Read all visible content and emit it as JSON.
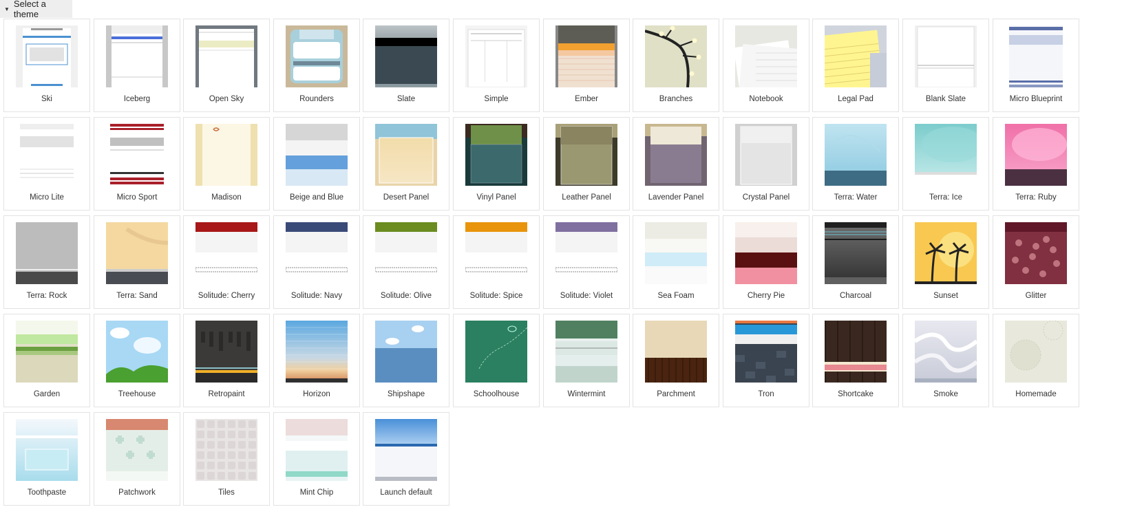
{
  "header": {
    "title": "Select a theme",
    "caret_icon": "caret-down-icon"
  },
  "themes": [
    {
      "id": "ski",
      "label": "Ski"
    },
    {
      "id": "iceberg",
      "label": "Iceberg"
    },
    {
      "id": "open-sky",
      "label": "Open Sky"
    },
    {
      "id": "rounders",
      "label": "Rounders"
    },
    {
      "id": "slate",
      "label": "Slate"
    },
    {
      "id": "simple",
      "label": "Simple"
    },
    {
      "id": "ember",
      "label": "Ember"
    },
    {
      "id": "branches",
      "label": "Branches"
    },
    {
      "id": "notebook",
      "label": "Notebook"
    },
    {
      "id": "legal-pad",
      "label": "Legal Pad"
    },
    {
      "id": "blank-slate",
      "label": "Blank Slate"
    },
    {
      "id": "micro-blueprint",
      "label": "Micro Blueprint"
    },
    {
      "id": "micro-lite",
      "label": "Micro Lite"
    },
    {
      "id": "micro-sport",
      "label": "Micro Sport"
    },
    {
      "id": "madison",
      "label": "Madison"
    },
    {
      "id": "beige-and-blue",
      "label": "Beige and Blue"
    },
    {
      "id": "desert-panel",
      "label": "Desert Panel"
    },
    {
      "id": "vinyl-panel",
      "label": "Vinyl Panel"
    },
    {
      "id": "leather-panel",
      "label": "Leather Panel"
    },
    {
      "id": "lavender-panel",
      "label": "Lavender Panel"
    },
    {
      "id": "crystal-panel",
      "label": "Crystal Panel"
    },
    {
      "id": "terra-water",
      "label": "Terra: Water"
    },
    {
      "id": "terra-ice",
      "label": "Terra: Ice"
    },
    {
      "id": "terra-ruby",
      "label": "Terra: Ruby"
    },
    {
      "id": "terra-rock",
      "label": "Terra: Rock"
    },
    {
      "id": "terra-sand",
      "label": "Terra: Sand"
    },
    {
      "id": "solitude-cherry",
      "label": "Solitude: Cherry"
    },
    {
      "id": "solitude-navy",
      "label": "Solitude: Navy"
    },
    {
      "id": "solitude-olive",
      "label": "Solitude: Olive"
    },
    {
      "id": "solitude-spice",
      "label": "Solitude: Spice"
    },
    {
      "id": "solitude-violet",
      "label": "Solitude: Violet"
    },
    {
      "id": "sea-foam",
      "label": "Sea Foam"
    },
    {
      "id": "cherry-pie",
      "label": "Cherry Pie"
    },
    {
      "id": "charcoal",
      "label": "Charcoal"
    },
    {
      "id": "sunset",
      "label": "Sunset"
    },
    {
      "id": "glitter",
      "label": "Glitter"
    },
    {
      "id": "garden",
      "label": "Garden"
    },
    {
      "id": "treehouse",
      "label": "Treehouse"
    },
    {
      "id": "retropaint",
      "label": "Retropaint"
    },
    {
      "id": "horizon",
      "label": "Horizon"
    },
    {
      "id": "shipshape",
      "label": "Shipshape"
    },
    {
      "id": "schoolhouse",
      "label": "Schoolhouse"
    },
    {
      "id": "wintermint",
      "label": "Wintermint"
    },
    {
      "id": "parchment",
      "label": "Parchment"
    },
    {
      "id": "tron",
      "label": "Tron"
    },
    {
      "id": "shortcake",
      "label": "Shortcake"
    },
    {
      "id": "smoke",
      "label": "Smoke"
    },
    {
      "id": "homemade",
      "label": "Homemade"
    },
    {
      "id": "toothpaste",
      "label": "Toothpaste"
    },
    {
      "id": "patchwork",
      "label": "Patchwork"
    },
    {
      "id": "tiles",
      "label": "Tiles"
    },
    {
      "id": "mint-chip",
      "label": "Mint Chip"
    },
    {
      "id": "launch-default",
      "label": "Launch default"
    }
  ]
}
